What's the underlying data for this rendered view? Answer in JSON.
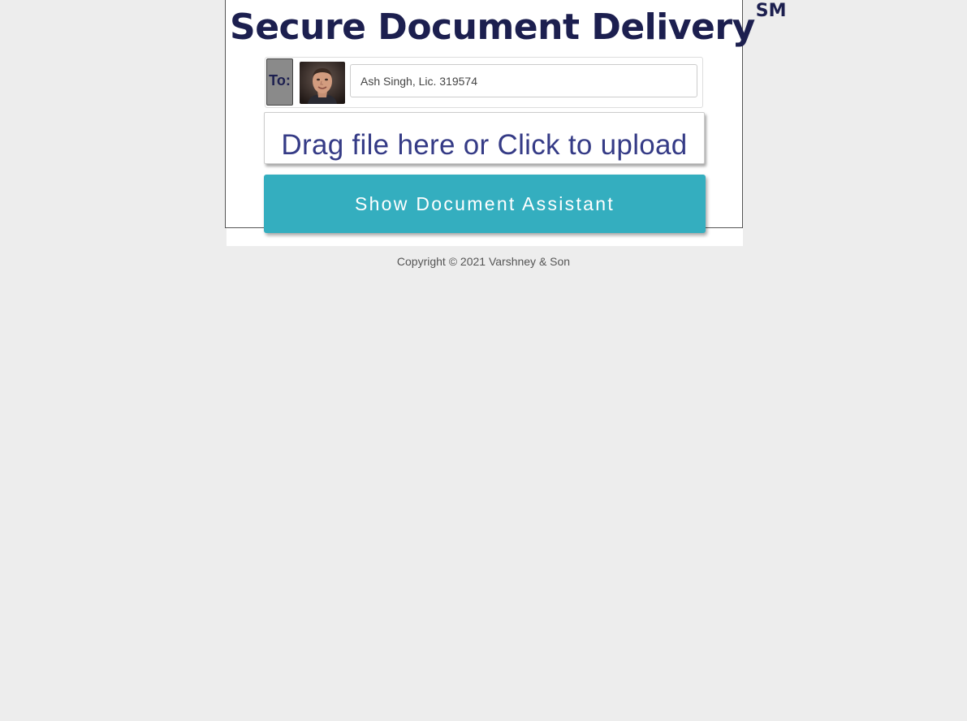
{
  "header": {
    "title": "Secure Document Delivery",
    "title_mark": "SM"
  },
  "recipient": {
    "label": "To:",
    "avatar_icon": "person-photo",
    "value": "Ash Singh, Lic. 319574"
  },
  "upload": {
    "label": "Drag file here or Click to upload"
  },
  "assistant": {
    "label": "Show Document Assistant"
  },
  "footer": {
    "copyright": "Copyright © 2021 Varshney & Son"
  },
  "colors": {
    "title": "#1c1f4f",
    "upload_text": "#353b86",
    "button_bg": "#34aebf",
    "page_bg": "#ededed"
  }
}
